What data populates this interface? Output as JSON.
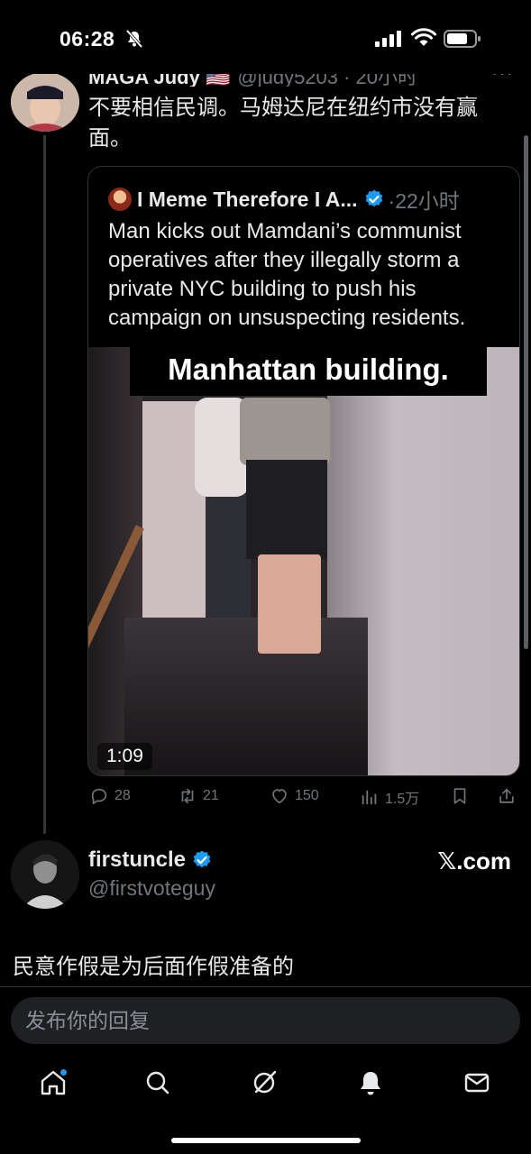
{
  "status_bar": {
    "time": "06:28",
    "icons": [
      "mute-icon",
      "signal-icon",
      "wifi-icon",
      "battery-icon"
    ]
  },
  "parent_tweet": {
    "author_name": "MAGA Judy 🇺🇸",
    "handle_time": "@judy5203 · 20小时",
    "text": "不要相信民调。马姆达尼在纽约市没有赢面。",
    "more_label": "···"
  },
  "quoted_tweet": {
    "author_name": "I Meme Therefore I A...",
    "time": "·22小时",
    "text": "Man kicks out Mamdani’s communist operatives after they illegally storm a private NYC building to push his campaign on unsuspecting residents.",
    "video_caption": "Manhattan building.",
    "video_duration": "1:09"
  },
  "actions": {
    "replies": "28",
    "reposts": "21",
    "likes": "150",
    "views": "1.5万"
  },
  "reply": {
    "author_name": "firstuncle",
    "handle": "@firstvoteguy",
    "source": "𝕏.com",
    "text": "民意作假是为后面作假准备的"
  },
  "composer": {
    "placeholder": "发布你的回复"
  },
  "nav": {
    "items": [
      "home-icon",
      "search-icon",
      "grok-icon",
      "notifications-icon",
      "messages-icon"
    ]
  },
  "colors": {
    "background": "#000000",
    "text": "#e7e9ea",
    "muted": "#71767b",
    "accent": "#1d9bf0"
  }
}
